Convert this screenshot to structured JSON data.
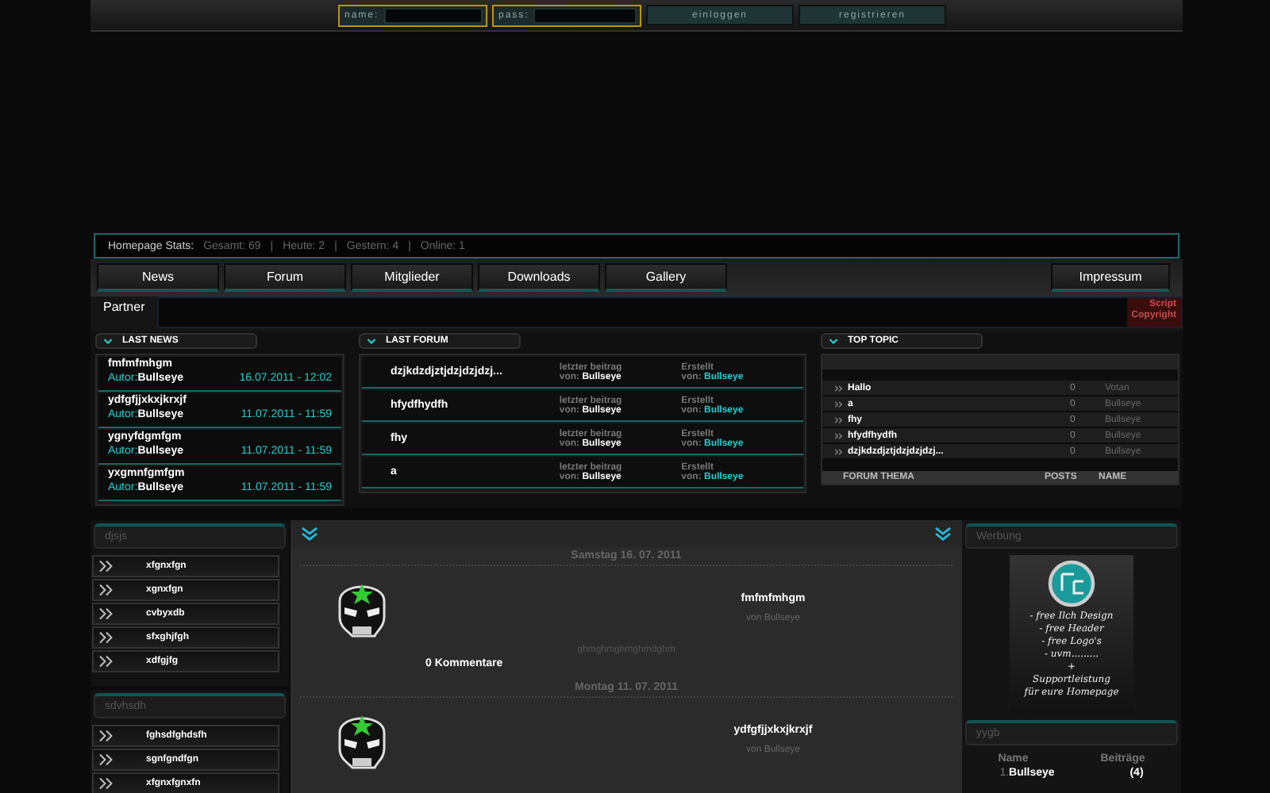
{
  "login_bar": {
    "name_label": "name:",
    "pass_label": "pass:",
    "buttons": [
      "einloggen",
      "registrieren"
    ]
  },
  "stats": {
    "label": "Homepage Stats:",
    "separator": "|",
    "items": [
      "Gesamt: 69",
      "Heute: 2",
      "Gestern: 4",
      "Online: 1"
    ]
  },
  "nav": {
    "items": [
      "News",
      "Forum",
      "Mitglieder",
      "Downloads",
      "Gallery"
    ],
    "right_item": "Impressum"
  },
  "partner": {
    "label": "Partner",
    "badge_lines": [
      "Script",
      "Copyright"
    ]
  },
  "last_news": {
    "title": "LAST NEWS",
    "items": [
      {
        "title": "fmfmfmhgm",
        "author_label": "Autor:",
        "author": "Bullseye",
        "date": "16.07.2011 - 12:02"
      },
      {
        "title": "ydfgfjjxkxjkrxjf",
        "author_label": "Autor:",
        "author": "Bullseye",
        "date": "11.07.2011 - 11:59"
      },
      {
        "title": "ygnyfdgmfgm",
        "author_label": "Autor:",
        "author": "Bullseye",
        "date": "11.07.2011 - 11:59"
      },
      {
        "title": "yxgmnfgmfgm",
        "author_label": "Autor:",
        "author": "Bullseye",
        "date": "11.07.2011 - 11:59"
      }
    ]
  },
  "last_forum": {
    "title": "LAST FORUM",
    "items": [
      {
        "title": "dzjkdzdjztjdzjdzjdzj...",
        "last_label": "letzter beitrag",
        "last_by_label": "von:",
        "last_by": "Bullseye",
        "created_label": "Erstellt",
        "created_by_label": "von:",
        "created_by": "Bullseye"
      },
      {
        "title": "hfydfhydfh",
        "last_label": "letzter beitrag",
        "last_by_label": "von:",
        "last_by": "Bullseye",
        "created_label": "Erstellt",
        "created_by_label": "von:",
        "created_by": "Bullseye"
      },
      {
        "title": "fhy",
        "last_label": "letzter beitrag",
        "last_by_label": "von:",
        "last_by": "Bullseye",
        "created_label": "Erstellt",
        "created_by_label": "von:",
        "created_by": "Bullseye"
      },
      {
        "title": "a",
        "last_label": "letzter beitrag",
        "last_by_label": "von:",
        "last_by": "Bullseye",
        "created_label": "Erstellt",
        "created_by_label": "von:",
        "created_by": "Bullseye"
      }
    ]
  },
  "top_topic": {
    "title": "TOP TOPIC",
    "rows": [
      {
        "topic": "Hallo",
        "posts": "0",
        "name": "Votan"
      },
      {
        "topic": "a",
        "posts": "0",
        "name": "Bullseye"
      },
      {
        "topic": "fhy",
        "posts": "0",
        "name": "Bullseye"
      },
      {
        "topic": "hfydfhydfh",
        "posts": "0",
        "name": "Bullseye"
      },
      {
        "topic": "dzjkdzdjztjdzjdzjdzj...",
        "posts": "0",
        "name": "Bullseye"
      }
    ],
    "columns": [
      "FORUM THEMA",
      "POSTS",
      "NAME"
    ]
  },
  "left_boxes": [
    {
      "title": "djsjs",
      "items": [
        "xfgnxfgn",
        "xgnxfgn",
        "cvbyxdb",
        "sfxghjfgh",
        "xdfgjfg"
      ]
    },
    {
      "title": "sdvhsdh",
      "items": [
        "fghsdfghdsfh",
        "sgnfgndfgn",
        "xfgnxfgnxfn"
      ]
    }
  ],
  "posts": [
    {
      "date": "Samstag 16. 07. 2011",
      "title": "fmfmfmhgm",
      "byline": "von Bullseye",
      "body": "ghmghmghmghmdghm",
      "comments": "0 Kommentare"
    },
    {
      "date": "Montag 11. 07. 2011",
      "title": "ydfgfjjxkxjkrxjf",
      "byline": "von Bullseye"
    }
  ],
  "ad": {
    "title": "Werbung",
    "lines": [
      "- free Ilch Design",
      "- free Header",
      "- free Logo's",
      "- uvm.........",
      "+",
      "Supportleistung",
      "für eure Homepage"
    ]
  },
  "user_stats": {
    "title": "yygb",
    "columns": [
      "Name",
      "Beiträge"
    ],
    "rows": [
      {
        "rank": "1.",
        "name": "Bullseye",
        "count": "(4)"
      }
    ]
  }
}
